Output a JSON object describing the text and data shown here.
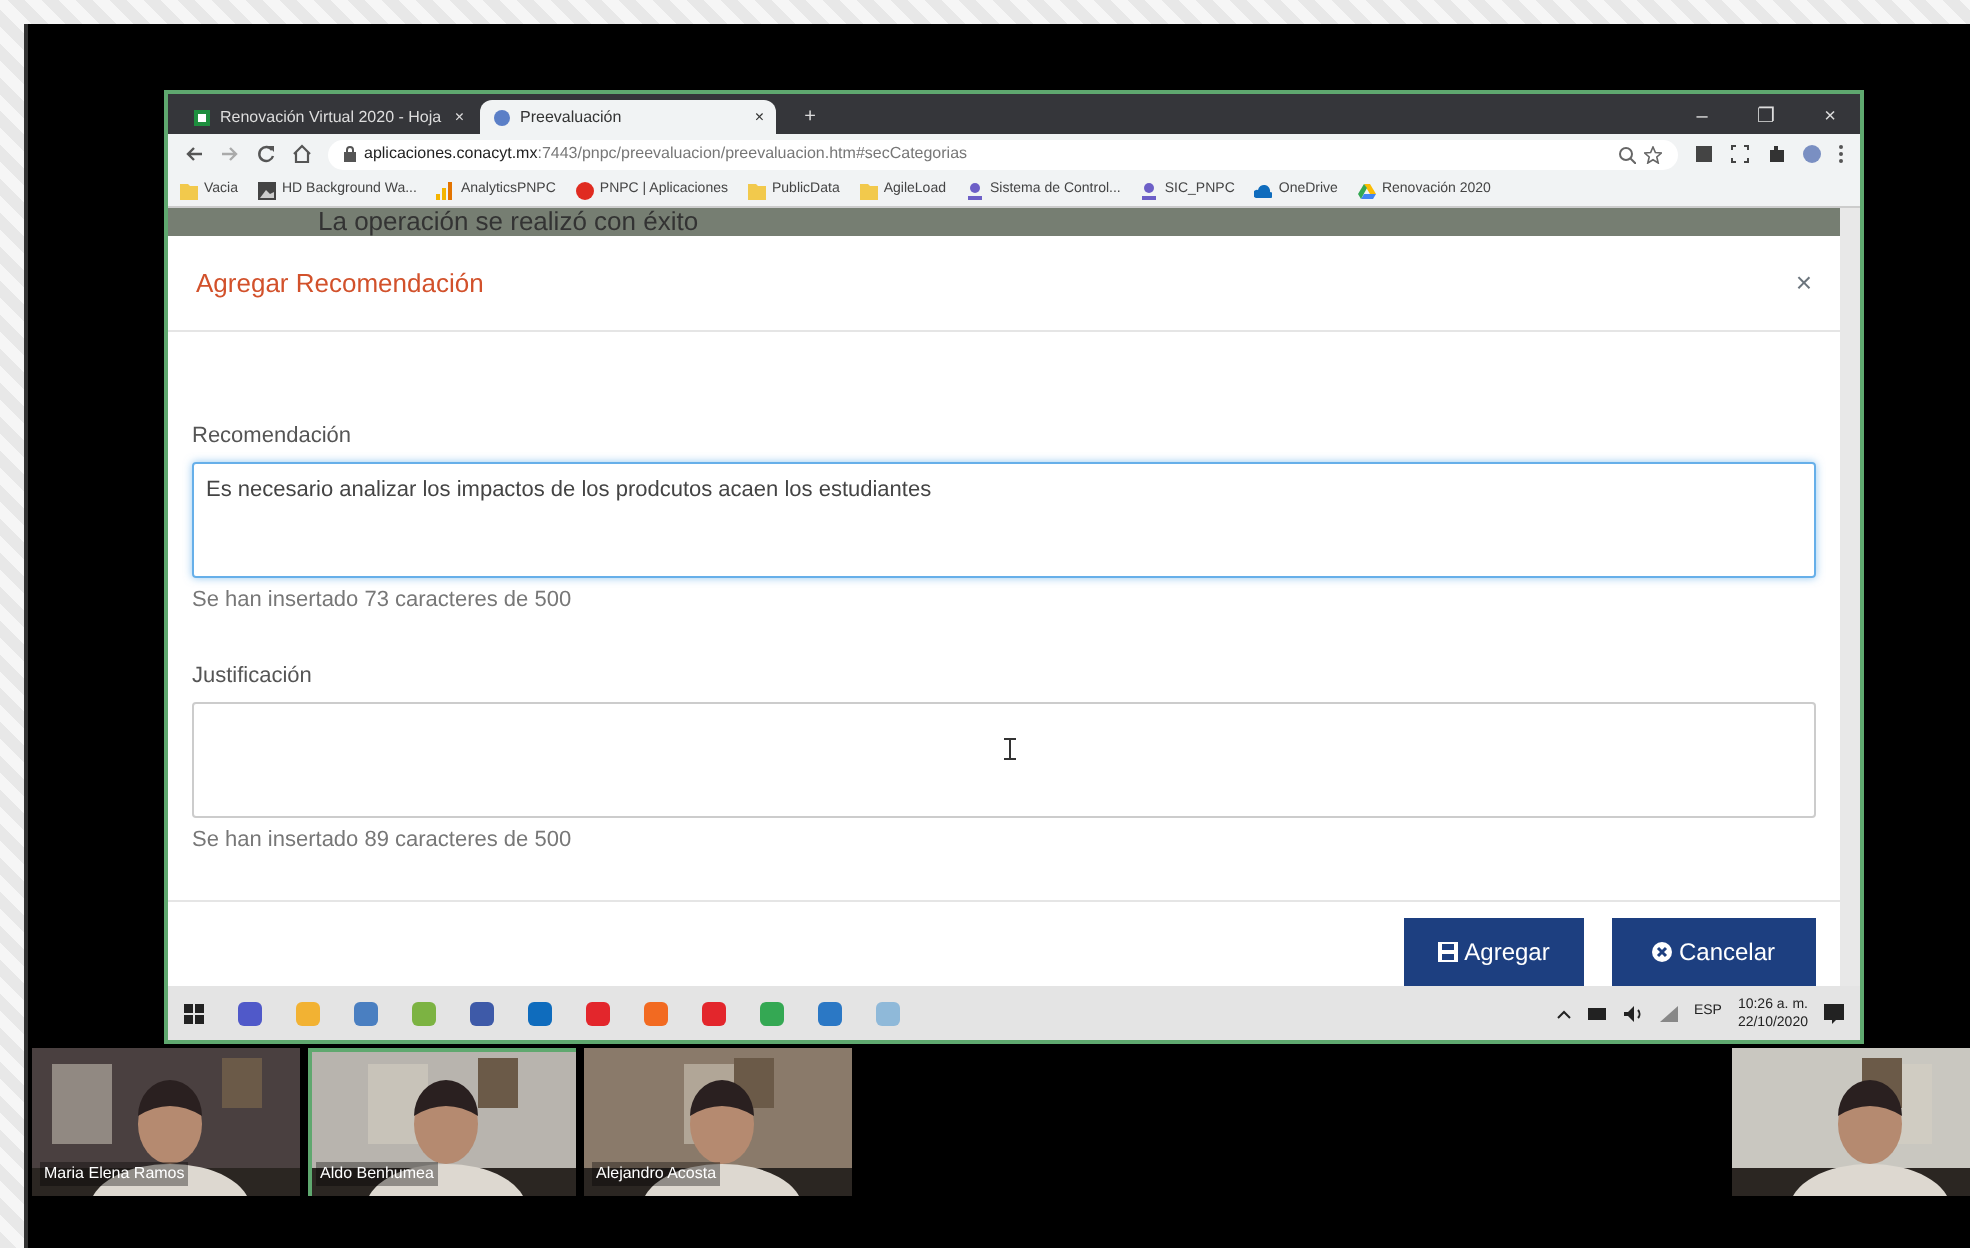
{
  "browser": {
    "tabs": [
      {
        "label": "Renovación Virtual 2020 - Hoja",
        "close": "×",
        "selected": false
      },
      {
        "label": "Preevaluación",
        "close": "×",
        "selected": true
      }
    ],
    "new_tab": "+",
    "window_controls": [
      "–",
      "❐",
      "×"
    ],
    "url_host": "aplicaciones.conacyt.mx",
    "url_path": ":7443/pnpc/preevaluacion/preevaluacion.htm#secCategorias",
    "bookmarks": [
      {
        "label": "Vacia"
      },
      {
        "label": "HD Background Wa..."
      },
      {
        "label": "AnalyticsPNPC"
      },
      {
        "label": "PNPC | Aplicaciones"
      },
      {
        "label": "PublicData"
      },
      {
        "label": "AgileLoad"
      },
      {
        "label": "Sistema de Control..."
      },
      {
        "label": "SIC_PNPC"
      },
      {
        "label": "OneDrive"
      },
      {
        "label": "Renovación 2020"
      }
    ]
  },
  "page": {
    "notice": "La operación se realizó con éxito",
    "modal": {
      "title": "Agregar Recomendación",
      "close": "×",
      "fields": [
        {
          "label": "Recomendación",
          "value": "Es necesario analizar los impactos de los prodcutos acaen los estudiantes",
          "focused": true,
          "counter": "Se han insertado 73 caracteres de 500"
        },
        {
          "label": "Justificación",
          "focused": false,
          "counter": "Se han insertado 89 caracteres de 500"
        }
      ],
      "buttons": [
        {
          "label": "Agregar",
          "kind": "save"
        },
        {
          "label": "Cancelar",
          "kind": "cancel"
        }
      ]
    }
  },
  "taskbar": {
    "language": "ESP",
    "time": "10:26 a. m.",
    "date": "22/10/2020"
  },
  "participants": [
    {
      "name": "Maria Elena Ramos",
      "speaking": false
    },
    {
      "name": "Aldo Benhumea",
      "speaking": true
    },
    {
      "name": "Alejandro Acosta",
      "speaking": false
    }
  ]
}
